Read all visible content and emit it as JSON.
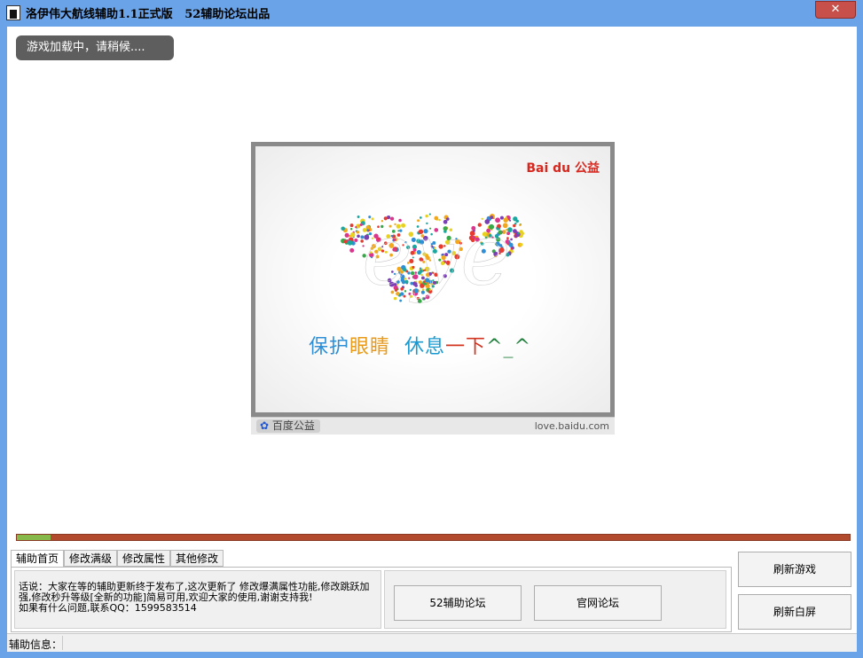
{
  "window": {
    "title": "洛伊伟大航线辅助1.1正式版   52辅助论坛出品",
    "close_label": "✕"
  },
  "toast": "游戏加载中，请稍候....",
  "ad": {
    "brand_logo": "Bai du 公益",
    "art_word": "eye",
    "slogan": [
      "保护",
      "眼睛",
      "休息",
      "一下",
      "^_^"
    ],
    "footer_left": "百度公益",
    "footer_right": "love.baidu.com",
    "colors": {
      "slogan_blue": "#2f8fd6",
      "slogan_orange": "#e89a18",
      "slogan_teal": "#1a9ad0",
      "slogan_green": "#1e7f3a",
      "slogan_red": "#d2341f",
      "brand_red": "#d7281f",
      "brand_blue": "#2157d3"
    }
  },
  "progress": {
    "value": 0.04,
    "fill_color": "#86b94a",
    "track_color": "#b24a2e"
  },
  "tabs": [
    {
      "label": "辅助首页",
      "active": true
    },
    {
      "label": "修改满级",
      "active": false
    },
    {
      "label": "修改属性",
      "active": false
    },
    {
      "label": "其他修改",
      "active": false
    }
  ],
  "notice": {
    "line1": "话说：大家在等的辅助更新终于发布了,这次更新了 修改爆满属性功能,修改跳跃加强,修改秒升等级[全新的功能]简易可用,欢迎大家的使用,谢谢支持我!",
    "line2": "如果有什么问题,联系QQ：1599583514"
  },
  "buttons": {
    "forum52": "52辅助论坛",
    "official_forum": "官网论坛",
    "refresh_game": "刷新游戏",
    "refresh_blank": "刷新白屏"
  },
  "status": {
    "label": "辅助信息：",
    "value": ""
  }
}
